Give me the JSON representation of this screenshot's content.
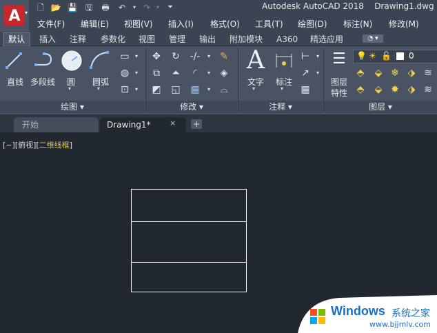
{
  "app": {
    "title": "Autodesk AutoCAD 2018",
    "file": "Drawing1.dwg",
    "logo_letter": "A"
  },
  "quick_access": [
    "new-icon",
    "open-icon",
    "save-icon",
    "saveas-icon",
    "print-icon",
    "undo-icon",
    "redo-icon",
    "dropdown-icon"
  ],
  "menus": [
    "文件(F)",
    "编辑(E)",
    "视图(V)",
    "插入(I)",
    "格式(O)",
    "工具(T)",
    "绘图(D)",
    "标注(N)",
    "修改(M)"
  ],
  "ribbon_tabs": [
    "默认",
    "插入",
    "注释",
    "参数化",
    "视图",
    "管理",
    "输出",
    "附加模块",
    "A360",
    "精选应用"
  ],
  "draw_panel": {
    "line": "直线",
    "polyline": "多段线",
    "circle": "圆",
    "arc": "圆弧",
    "title": "绘图"
  },
  "modify_panel": {
    "title": "修改"
  },
  "annotation_panel": {
    "text": "文字",
    "dimension": "标注",
    "title": "注释"
  },
  "layers_panel": {
    "properties_1": "图层",
    "properties_2": "特性",
    "layer_value": "0",
    "title": "图层"
  },
  "file_tabs": {
    "start": "开始",
    "drawing": "Drawing1*",
    "close": "×",
    "add": "+"
  },
  "viewport": {
    "prefix": "[−][俯视][",
    "style": "二维线框",
    "suffix": "]"
  },
  "watermark": {
    "brand": "Windows",
    "site_cn": "系统之家",
    "url": "www.bjjmlv.com"
  },
  "colors": {
    "accent_red": "#c8262c",
    "canvas": "#212830",
    "ribbon": "#4a5364"
  }
}
